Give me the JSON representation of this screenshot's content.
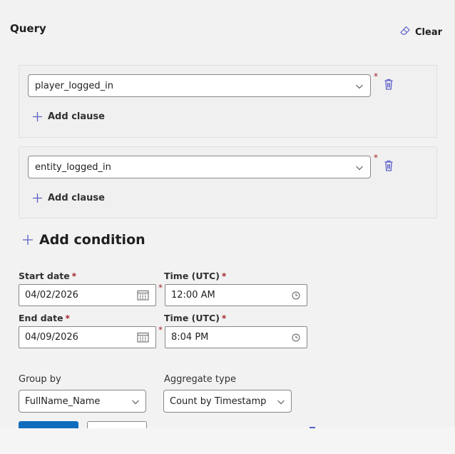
{
  "query": {
    "title": "Query",
    "clear_label": "Clear"
  },
  "conditions": [
    {
      "event": "player_logged_in",
      "add_clause_label": "Add clause"
    },
    {
      "event": "entity_logged_in",
      "add_clause_label": "Add clause"
    }
  ],
  "add_condition_label": "Add condition",
  "required_mark": "*",
  "start": {
    "date_label": "Start date",
    "date_value": "04/02/2026",
    "time_label": "Time (UTC)",
    "time_value": "12:00 AM"
  },
  "end": {
    "date_label": "End date",
    "date_value": "04/09/2026",
    "time_label": "Time (UTC)",
    "time_value": "8:04 PM"
  },
  "group_by": {
    "label": "Group by",
    "value": "FullName_Name"
  },
  "aggregate": {
    "label": "Aggregate type",
    "value": "Count by Timestamp"
  },
  "icons": {
    "clear": "eraser-icon",
    "delete": "trash-icon",
    "add": "plus-icon",
    "dropdown": "chevron-down-icon",
    "calendar": "calendar-icon",
    "clock": "clock-icon"
  },
  "colors": {
    "accent": "#0f6cbd",
    "icon_blue": "#5b5fc7",
    "required": "#a4262c"
  }
}
